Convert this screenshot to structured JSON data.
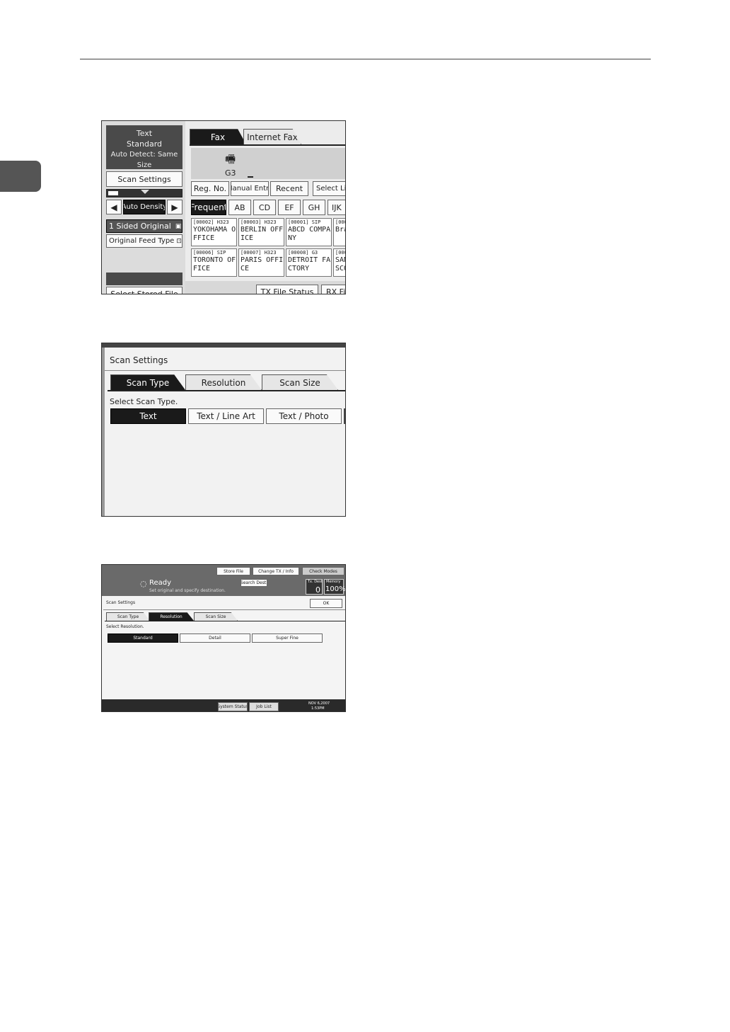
{
  "shot1": {
    "summary": [
      "Text",
      "Standard",
      "Auto Detect: Same Size"
    ],
    "scan_settings": "Scan Settings",
    "auto_density": "Auto Density",
    "sided_original": "1 Sided Original",
    "feed_type": "Original Feed Type",
    "select_stored_file": "Select Stored File",
    "tabs": [
      "Fax",
      "Internet Fax"
    ],
    "line_label": "G3",
    "entry_buttons": [
      "Reg. No.",
      "Manual Entry",
      "Recent",
      "Select Line"
    ],
    "index_tabs": [
      "Frequent",
      "AB",
      "CD",
      "EF",
      "GH",
      "IJK"
    ],
    "destinations": [
      {
        "id": "[00002] H323",
        "name": "YOKOHAMA O\nFFICE"
      },
      {
        "id": "[00003] H323",
        "name": "BERLIN OFF\nICE"
      },
      {
        "id": "[00001] SIP",
        "name": "ABCD COMPA\nNY"
      },
      {
        "id": "[0000",
        "name": "Bra"
      },
      {
        "id": "[00006] SIP",
        "name": "TORONTO OF\nFICE"
      },
      {
        "id": "[00007] H323",
        "name": "PARIS OFFI\nCE"
      },
      {
        "id": "[00008] G3",
        "name": "DETROIT FA\nCTORY"
      },
      {
        "id": "[0000",
        "name": "SAN\nSCO"
      }
    ],
    "footer_buttons": [
      "TX File Status",
      "RX File"
    ]
  },
  "shot2": {
    "title": "Scan Settings",
    "tabs": [
      "Scan Type",
      "Resolution",
      "Scan Size"
    ],
    "prompt": "Select Scan Type.",
    "options": [
      "Text",
      "Text / Line Art",
      "Text / Photo"
    ]
  },
  "shot3": {
    "top_buttons": [
      "Store File",
      "Change TX / Info",
      "Check Modes"
    ],
    "status": "Ready",
    "status_sub": "Set original and specify destination.",
    "search_dest": "Search Dest.",
    "tx_dest_label": "Tx. Dest",
    "tx_dest_value": "0",
    "memory_label": "Memory",
    "memory_value": "100%",
    "title": "Scan Settings",
    "ok": "OK",
    "tabs": [
      "Scan Type",
      "Resolution",
      "Scan Size"
    ],
    "prompt": "Select Resolution.",
    "options": [
      "Standard",
      "Detail",
      "Super Fine"
    ],
    "bottom_buttons": [
      "System Status",
      "Job List"
    ],
    "date": "NOV   6,2007",
    "time": "1:53PM"
  }
}
